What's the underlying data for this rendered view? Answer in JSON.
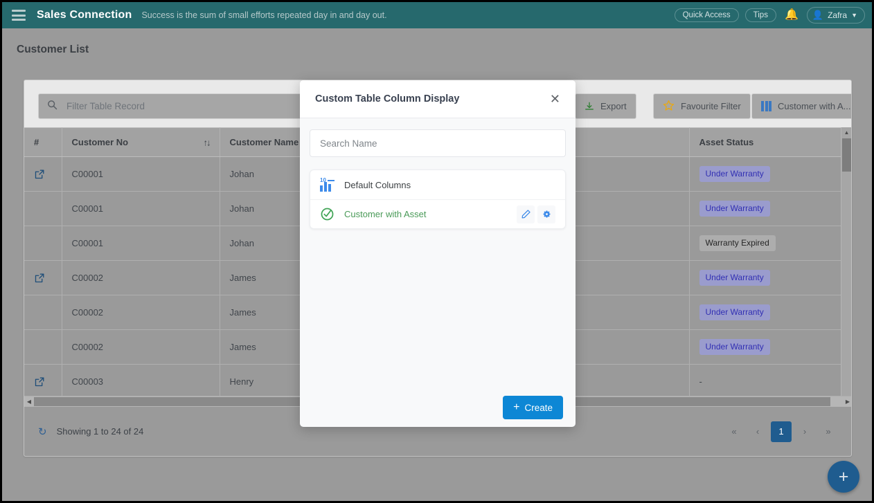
{
  "topbar": {
    "menu_icon": "hamburger-icon",
    "brand": "Sales Connection",
    "tagline": "Success is the sum of small efforts repeated day in and day out.",
    "quick_access": "Quick Access",
    "tips": "Tips",
    "bell_icon": "bell-icon",
    "user_name": "Zafra",
    "caret": "⌄",
    "bg_color": "#26696d"
  },
  "page": {
    "title": "Customer List"
  },
  "toolbar": {
    "search_placeholder": "Filter Table Record",
    "search_icon": "search-icon",
    "export_label": "Export",
    "favourite_filter_label": "Favourite Filter",
    "columns_label": "Customer with A...",
    "star_icon": "star-icon",
    "columns_icon": "columns-icon"
  },
  "table": {
    "columns": [
      "#",
      "Customer No",
      "Customer Name",
      "",
      "Asset Status"
    ],
    "sort_icon": "sort-ascending-descending-icon",
    "open_icon": "open-external-icon",
    "rows": [
      {
        "open": true,
        "customer_no": "C00001",
        "customer_name": "Johan",
        "mid": "",
        "status": "Under Warranty",
        "status_type": "warranty"
      },
      {
        "open": false,
        "customer_no": "C00001",
        "customer_name": "Johan",
        "mid": "",
        "status": "Under Warranty",
        "status_type": "warranty"
      },
      {
        "open": false,
        "customer_no": "C00001",
        "customer_name": "Johan",
        "mid": "",
        "status": "Warranty Expired",
        "status_type": "expired"
      },
      {
        "open": true,
        "customer_no": "C00002",
        "customer_name": "James",
        "mid": "",
        "status": "Under Warranty",
        "status_type": "warranty"
      },
      {
        "open": false,
        "customer_no": "C00002",
        "customer_name": "James",
        "mid": "",
        "status": "Under Warranty",
        "status_type": "warranty"
      },
      {
        "open": false,
        "customer_no": "C00002",
        "customer_name": "James",
        "mid": "",
        "status": "Under Warranty",
        "status_type": "warranty"
      },
      {
        "open": true,
        "customer_no": "C00003",
        "customer_name": "Henry",
        "mid": "",
        "status": "-",
        "status_type": "none"
      }
    ]
  },
  "footer": {
    "refresh_icon": "refresh-icon",
    "showing": "Showing 1 to 24 of 24",
    "pager": [
      {
        "label": "«",
        "name": "pager-first",
        "active": false
      },
      {
        "label": "‹",
        "name": "pager-prev",
        "active": false
      },
      {
        "label": "1",
        "name": "pager-page-1",
        "active": true
      },
      {
        "label": "›",
        "name": "pager-next",
        "active": false
      },
      {
        "label": "»",
        "name": "pager-last",
        "active": false
      }
    ]
  },
  "fab": {
    "label": "+"
  },
  "modal": {
    "title": "Custom Table Column Display",
    "close_icon": "close-icon",
    "search_placeholder": "Search Name",
    "items": [
      {
        "label": "Default Columns",
        "icon": "bar-chart-10-icon",
        "color": "default",
        "actions": []
      },
      {
        "label": "Customer with Asset",
        "icon": "check-circle-icon",
        "color": "green",
        "actions": [
          "edit-icon",
          "settings-gear-icon"
        ]
      }
    ],
    "create_label": "Create",
    "create_plus": "+",
    "create_color": "#0d87d5"
  }
}
